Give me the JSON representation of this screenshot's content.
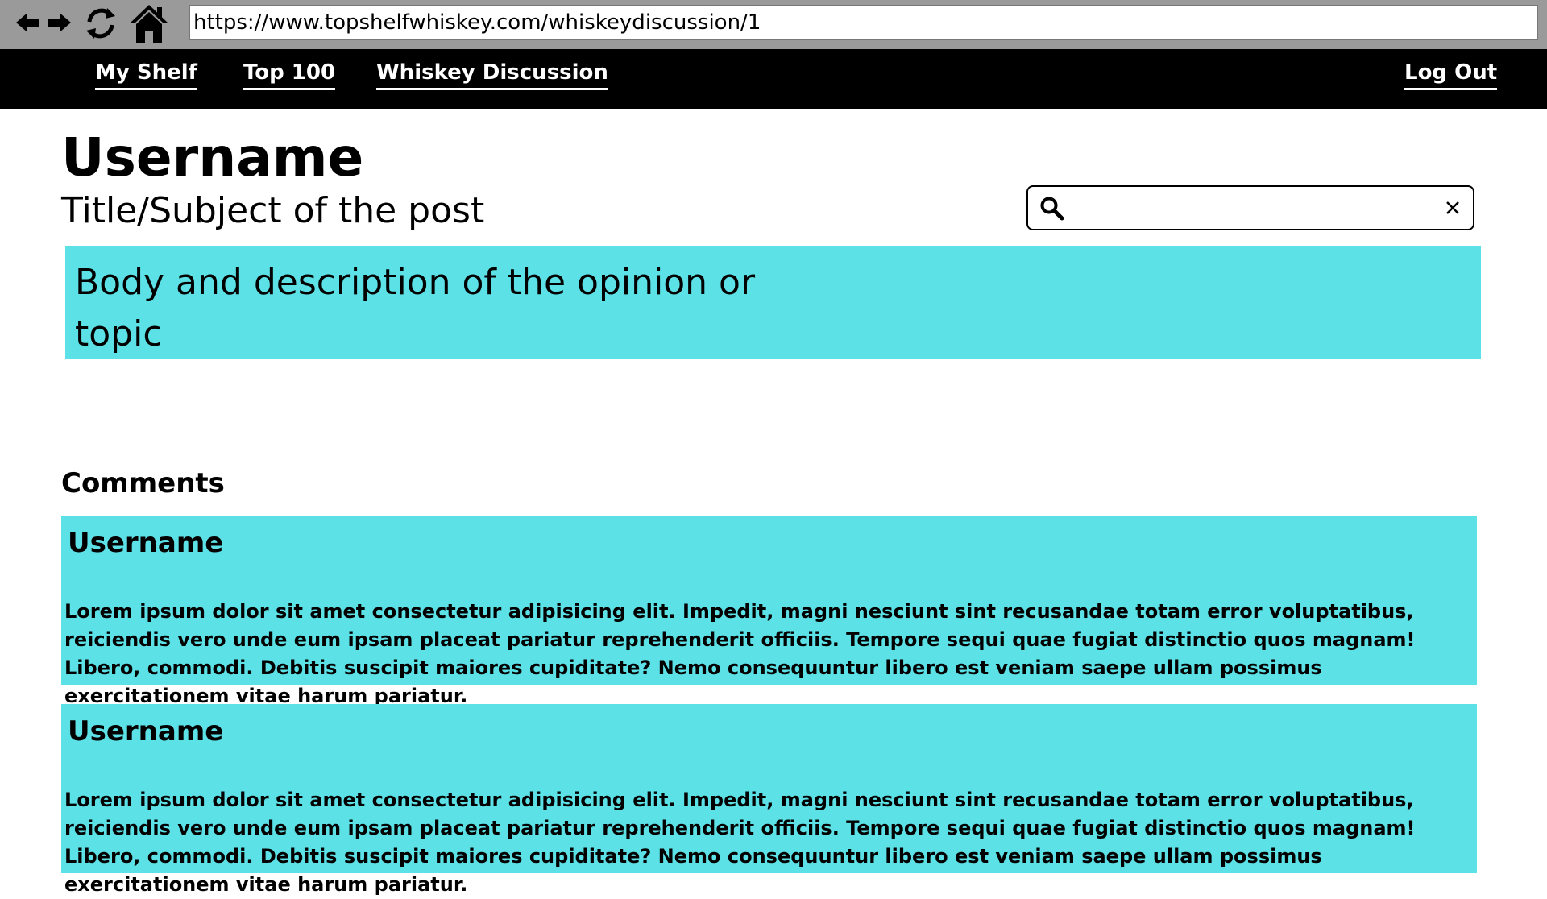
{
  "browser": {
    "url": "https://www.topshelfwhiskey.com/whiskeydiscussion/1",
    "icons": [
      "arrow-left-icon",
      "arrow-right-icon",
      "refresh-icon",
      "home-icon"
    ]
  },
  "nav": {
    "my_shelf": "My Shelf",
    "top100": "Top 100",
    "discussion": "Whiskey Discussion",
    "logout": "Log Out"
  },
  "post": {
    "username": "Username",
    "title": "Title/Subject of the post",
    "body": "Body and description of the opinion or topic"
  },
  "search": {
    "value": "",
    "icons": [
      "search-icon",
      "close-icon"
    ]
  },
  "comments": {
    "heading": "Comments",
    "items": [
      {
        "username": "Username",
        "text": "Lorem ipsum dolor sit amet consectetur adipisicing elit. Impedit, magni nesciunt sint recusandae totam error voluptatibus, reiciendis vero unde eum ipsam placeat pariatur reprehenderit officiis. Tempore sequi quae fugiat distinctio quos magnam! Libero, commodi. Debitis suscipit maiores cupiditate? Nemo consequuntur libero est veniam saepe ullam possimus exercitationem vitae harum pariatur."
      },
      {
        "username": "Username",
        "text": "Lorem ipsum dolor sit amet consectetur adipisicing elit. Impedit, magni nesciunt sint recusandae totam error voluptatibus, reiciendis vero unde eum ipsam placeat pariatur reprehenderit officiis. Tempore sequi quae fugiat distinctio quos magnam! Libero, commodi. Debitis suscipit maiores cupiditate? Nemo consequuntur libero est veniam saepe ullam possimus exercitationem vitae harum pariatur."
      }
    ]
  },
  "colors": {
    "chrome": "#9a9a9a",
    "nav_bg": "#000000",
    "accent_cyan": "#5ce1e6"
  }
}
